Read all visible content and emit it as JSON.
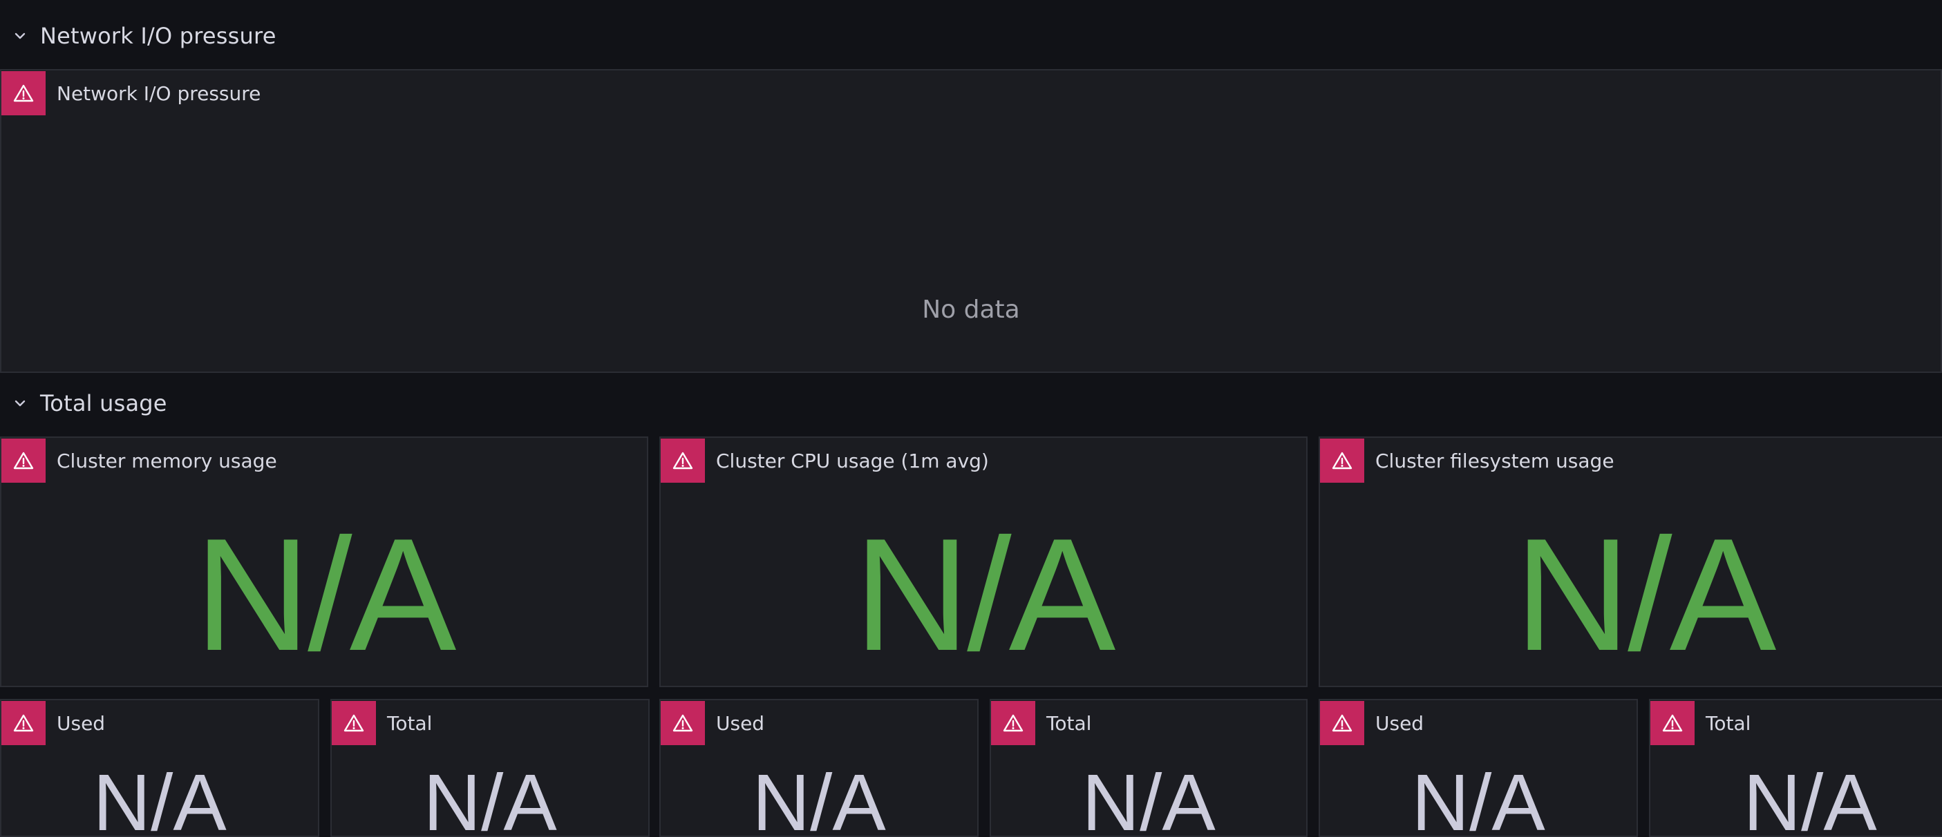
{
  "rows": [
    {
      "title": "Network I/O pressure",
      "chevron_icon": "chevron-down-icon"
    },
    {
      "title": "Total usage",
      "chevron_icon": "chevron-down-icon"
    }
  ],
  "network_panel": {
    "title": "Network I/O pressure",
    "message": "No data",
    "status_icon": "warning-triangle-icon"
  },
  "usage_panels": [
    {
      "title": "Cluster memory usage",
      "value": "N/A",
      "value_color": "#56a64b"
    },
    {
      "title": "Cluster CPU usage (1m avg)",
      "value": "N/A",
      "value_color": "#56a64b"
    },
    {
      "title": "Cluster filesystem usage",
      "value": "N/A",
      "value_color": "#56a64b"
    }
  ],
  "small_panels": [
    {
      "title": "Used",
      "value": "N/A"
    },
    {
      "title": "Total",
      "value": "N/A"
    },
    {
      "title": "Used",
      "value": "N/A"
    },
    {
      "title": "Total",
      "value": "N/A"
    },
    {
      "title": "Used",
      "value": "N/A"
    },
    {
      "title": "Total",
      "value": "N/A"
    }
  ],
  "colors": {
    "background": "#111217",
    "panel": "#1b1c21",
    "error_badge": "#c4265e",
    "stat_green": "#56a64b",
    "stat_neutral": "#ccccdc"
  }
}
